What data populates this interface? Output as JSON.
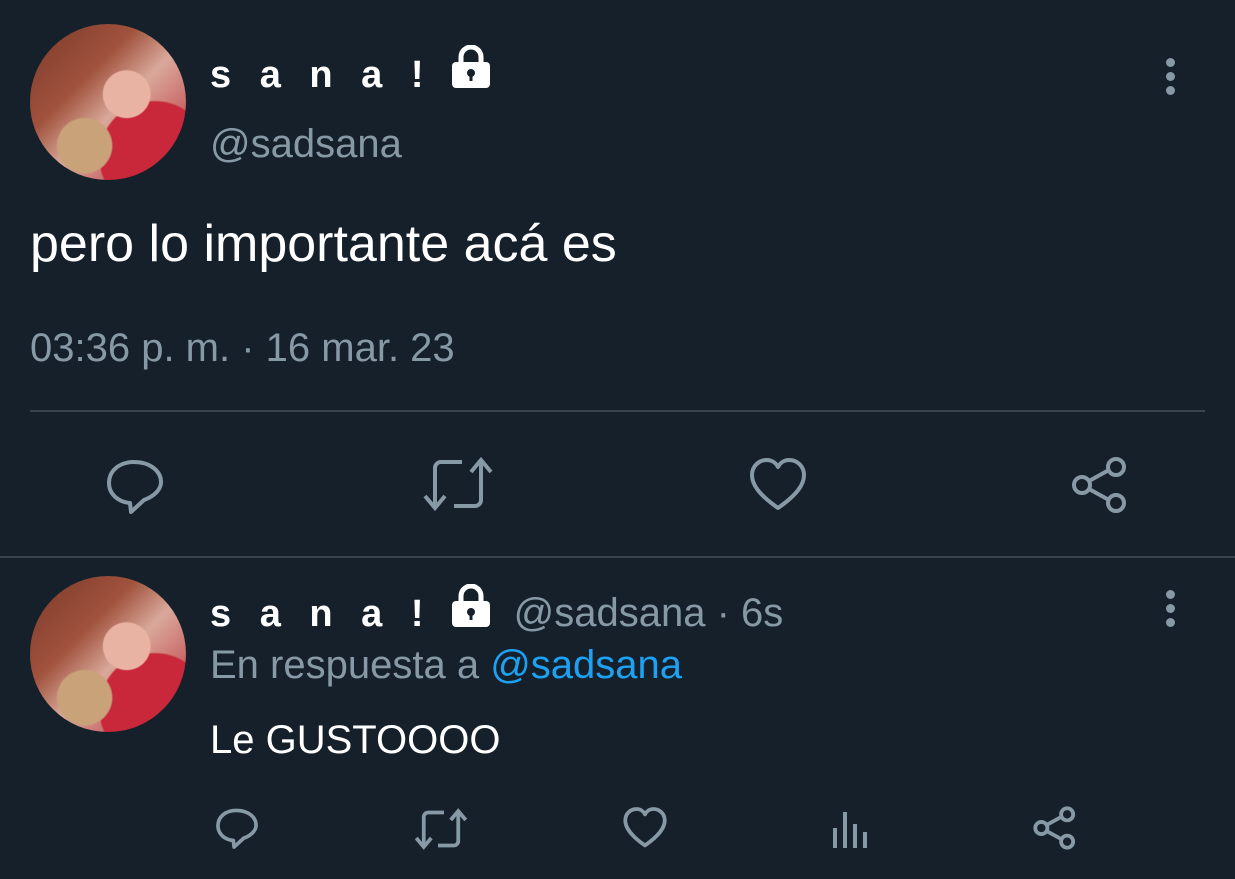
{
  "main_tweet": {
    "display_name": "s a n a !",
    "handle": "@sadsana",
    "text": "pero lo importante acá es",
    "timestamp": "03:36 p. m. · 16 mar. 23",
    "actions": [
      "reply-icon",
      "retweet-icon",
      "like-icon",
      "share-icon"
    ]
  },
  "reply_tweet": {
    "display_name": "s a n a !",
    "handle": "@sadsana",
    "separator": "·",
    "age": "6s",
    "in_reply_prefix": "En respuesta a",
    "in_reply_mention": "@sadsana",
    "text": "Le GUSTOOOO",
    "actions": [
      "reply-icon",
      "retweet-icon",
      "like-icon",
      "analytics-icon",
      "share-icon"
    ]
  },
  "colors": {
    "background": "#15202b",
    "text": "#ffffff",
    "muted": "#8899a6",
    "link": "#1da1f2",
    "divider": "#38444d"
  }
}
